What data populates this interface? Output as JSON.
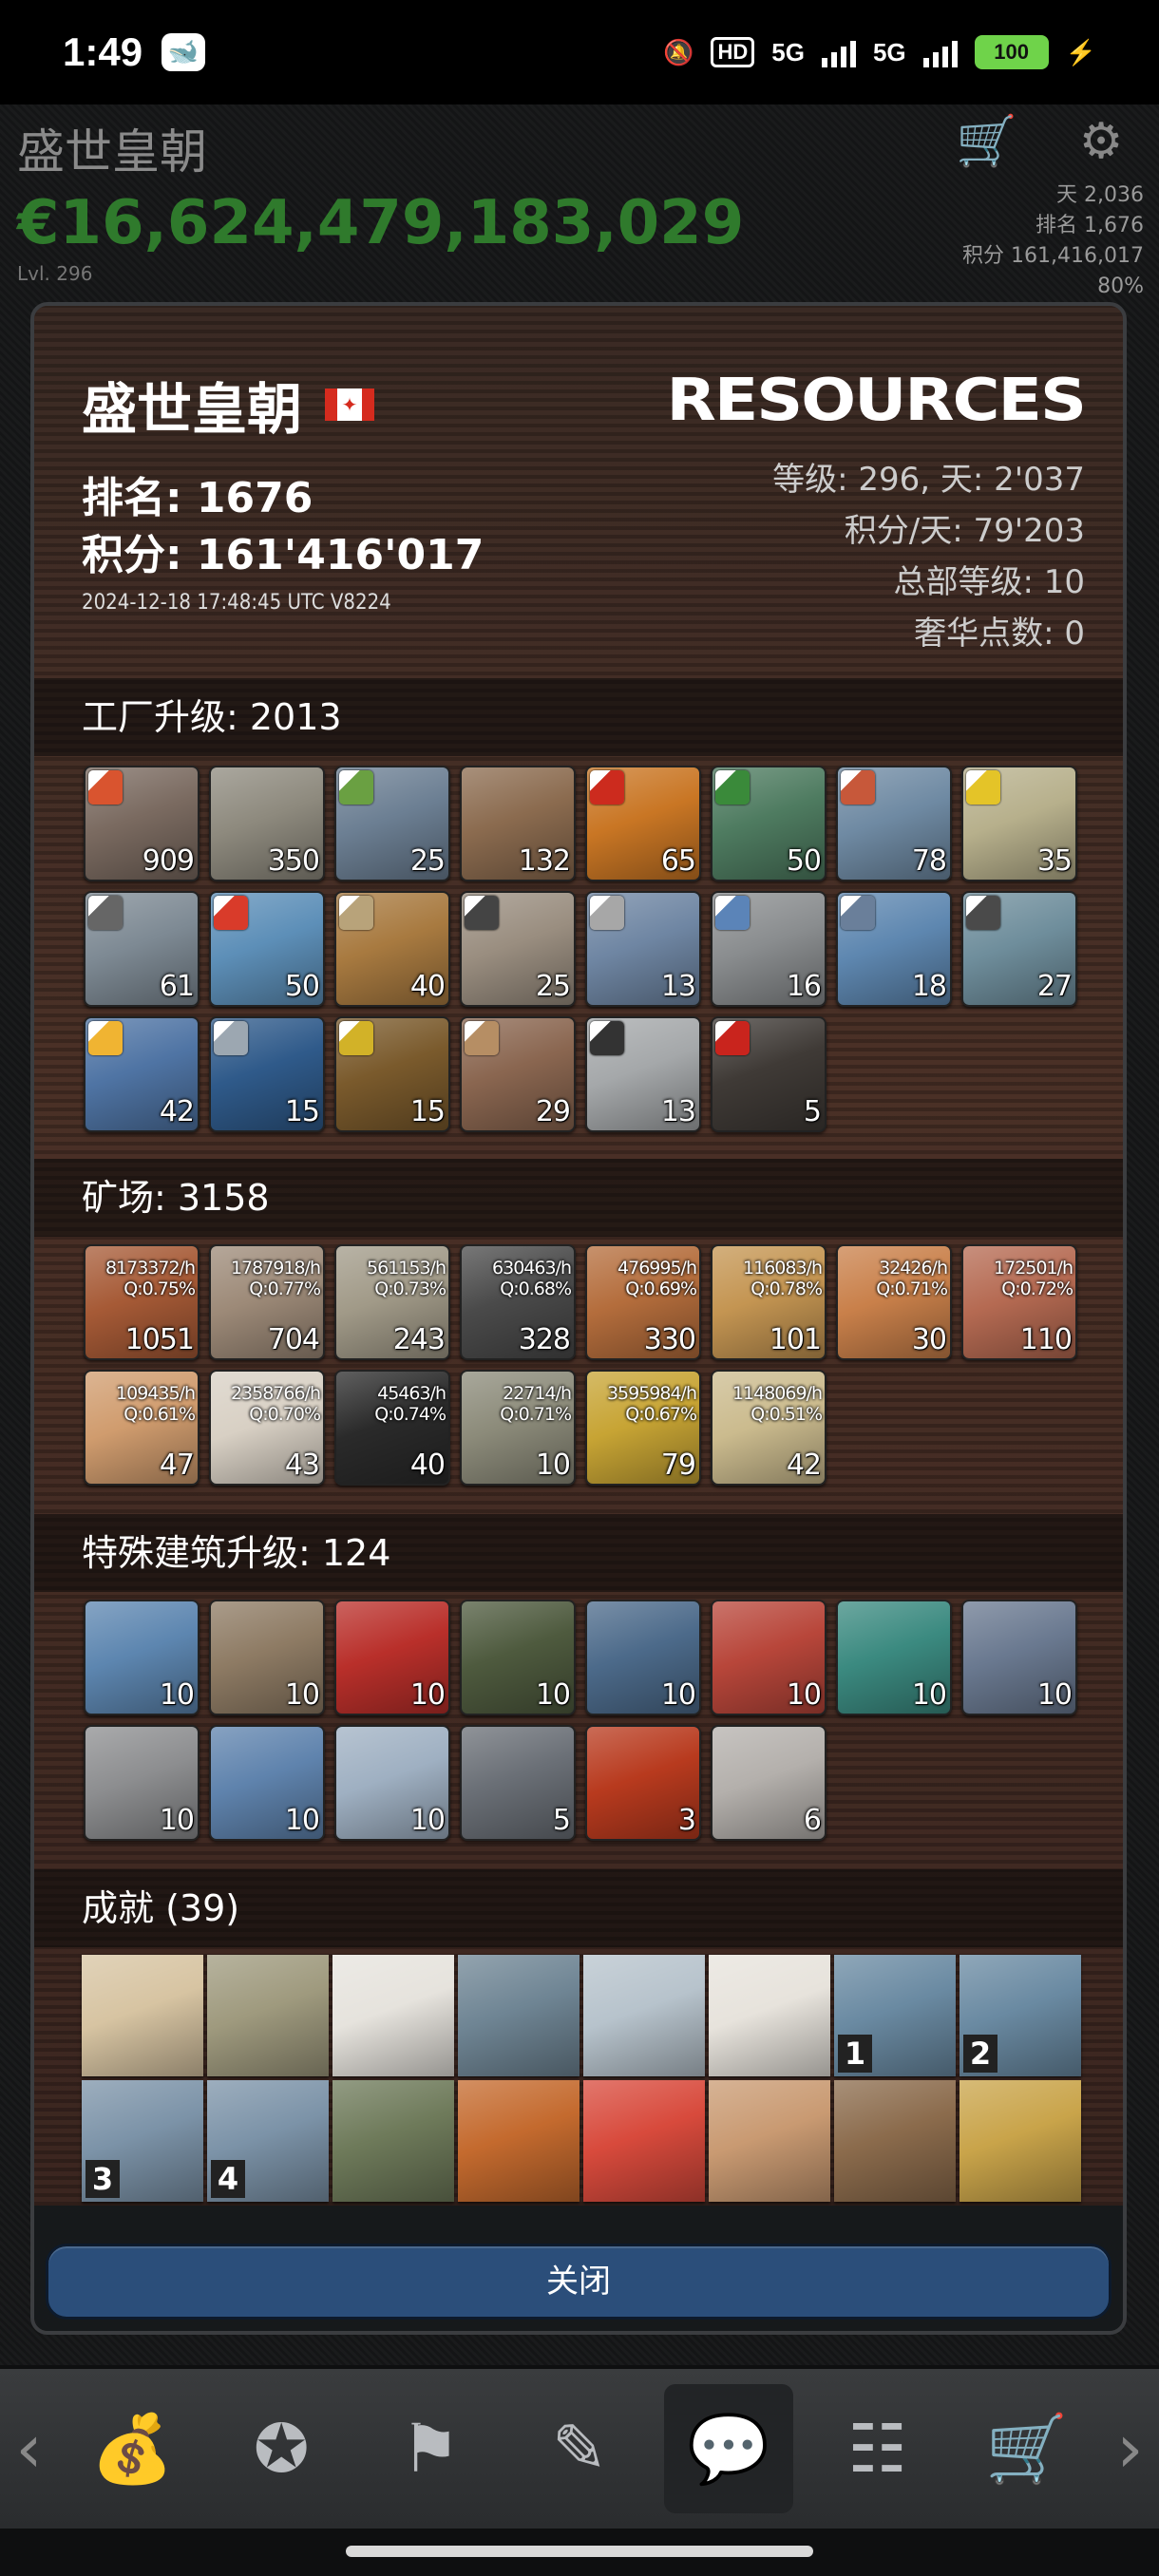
{
  "status_bar": {
    "time": "1:49",
    "net1": "5G",
    "net2": "5G",
    "hd": "HD",
    "battery": "100"
  },
  "game_header": {
    "company_name": "盛世皇朝",
    "cash": "€16,624,479,183,029",
    "level": "Lvl. 296",
    "day": "天 2,036",
    "rank": "排名 1,676",
    "score": "积分 161,416,017",
    "percent": "80%"
  },
  "dialog": {
    "company_name": "盛世皇朝",
    "flag": "canada-flag",
    "rank_label": "排名: 1676",
    "score_label": "积分: 161'416'017",
    "date": "2024-12-18 17:48:45 UTC V8224",
    "logo": "RESOURCES",
    "stats": {
      "level_day": "等级: 296, 天: 2'037",
      "score_per_day": "积分/天: 79'203",
      "hq_level": "总部等级: 10",
      "luxury_points": "奢华点数: 0"
    },
    "factories": {
      "title": "工厂升级: 2013",
      "items": [
        {
          "value": "909",
          "bg": "#7a6a60",
          "badge": "#d9542f"
        },
        {
          "value": "350",
          "bg": "#8e8a7e",
          "badge": ""
        },
        {
          "value": "25",
          "bg": "#6c7f93",
          "badge": "#6aa042"
        },
        {
          "value": "132",
          "bg": "#8b6b4f",
          "badge": ""
        },
        {
          "value": "65",
          "bg": "#c97624",
          "badge": "#cc2b1e"
        },
        {
          "value": "50",
          "bg": "#4e7b60",
          "badge": "#3a8a3a"
        },
        {
          "value": "78",
          "bg": "#6f8aa3",
          "badge": "#c7583a"
        },
        {
          "value": "35",
          "bg": "#b7b08c",
          "badge": "#e4c428"
        },
        {
          "value": "61",
          "bg": "#7e8a94",
          "badge": "#666"
        },
        {
          "value": "50",
          "bg": "#5d8fb8",
          "badge": "#d93b2a"
        },
        {
          "value": "40",
          "bg": "#a87a40",
          "badge": "#b8a37a"
        },
        {
          "value": "25",
          "bg": "#9a8e80",
          "badge": "#444"
        },
        {
          "value": "13",
          "bg": "#6f86a3",
          "badge": "#a7a7a7"
        },
        {
          "value": "16",
          "bg": "#8a8d8f",
          "badge": "#5b84b8"
        },
        {
          "value": "18",
          "bg": "#5e87b0",
          "badge": "#6a7f9a"
        },
        {
          "value": "27",
          "bg": "#6f8e9c",
          "badge": "#4a4a4a"
        },
        {
          "value": "42",
          "bg": "#4f74a4",
          "badge": "#f0b432"
        },
        {
          "value": "15",
          "bg": "#2f5a8a",
          "badge": "#9ca7b1"
        },
        {
          "value": "15",
          "bg": "#7a5a2c",
          "badge": "#d2b228"
        },
        {
          "value": "29",
          "bg": "#8a6650",
          "badge": "#b68e64"
        },
        {
          "value": "13",
          "bg": "#a5a8aa",
          "badge": "#333"
        },
        {
          "value": "5",
          "bg": "#3f3a36",
          "badge": "#c9241d"
        }
      ]
    },
    "mines": {
      "title": "矿场: 3158",
      "items": [
        {
          "rate": "8173372/h",
          "q": "Q:0.75%",
          "value": "1051",
          "bg": "#a65a36"
        },
        {
          "rate": "1787918/h",
          "q": "Q:0.77%",
          "value": "704",
          "bg": "#9d8a78"
        },
        {
          "rate": "561153/h",
          "q": "Q:0.73%",
          "value": "243",
          "bg": "#a19a88"
        },
        {
          "rate": "630463/h",
          "q": "Q:0.68%",
          "value": "328",
          "bg": "#4a4a4a"
        },
        {
          "rate": "476995/h",
          "q": "Q:0.69%",
          "value": "330",
          "bg": "#b46d3c"
        },
        {
          "rate": "116083/h",
          "q": "Q:0.78%",
          "value": "101",
          "bg": "#c49552"
        },
        {
          "rate": "32426/h",
          "q": "Q:0.71%",
          "value": "30",
          "bg": "#c9804a"
        },
        {
          "rate": "172501/h",
          "q": "Q:0.72%",
          "value": "110",
          "bg": "#b56a52"
        },
        {
          "rate": "109435/h",
          "q": "Q:0.61%",
          "value": "47",
          "bg": "#d09c6e"
        },
        {
          "rate": "2358766/h",
          "q": "Q:0.70%",
          "value": "43",
          "bg": "#d8d0c4"
        },
        {
          "rate": "45463/h",
          "q": "Q:0.74%",
          "value": "40",
          "bg": "#2a2a2a"
        },
        {
          "rate": "22714/h",
          "q": "Q:0.71%",
          "value": "10",
          "bg": "#8c8b7a"
        },
        {
          "rate": "3595984/h",
          "q": "Q:0.67%",
          "value": "79",
          "bg": "#c7a434"
        },
        {
          "rate": "1148069/h",
          "q": "Q:0.51%",
          "value": "42",
          "bg": "#cbbb8e"
        }
      ]
    },
    "special": {
      "title": "特殊建筑升级: 124",
      "items": [
        {
          "value": "10",
          "bg": "#5d86b0"
        },
        {
          "value": "10",
          "bg": "#8e7b64"
        },
        {
          "value": "10",
          "bg": "#b92f2a"
        },
        {
          "value": "10",
          "bg": "#4e5a3e"
        },
        {
          "value": "10",
          "bg": "#4c6a8a"
        },
        {
          "value": "10",
          "bg": "#b8463a"
        },
        {
          "value": "10",
          "bg": "#3b8a80"
        },
        {
          "value": "10",
          "bg": "#6a7990"
        },
        {
          "value": "10",
          "bg": "#8d8e90"
        },
        {
          "value": "10",
          "bg": "#5f83ad"
        },
        {
          "value": "10",
          "bg": "#9fb0c2"
        },
        {
          "value": "5",
          "bg": "#6a6f76"
        },
        {
          "value": "3",
          "bg": "#b83a1e"
        },
        {
          "value": "6",
          "bg": "#b4b0ac"
        }
      ]
    },
    "achievements": {
      "title": "成就 (39)",
      "items": [
        {
          "bg": "#d7c4a2",
          "idx": ""
        },
        {
          "bg": "#9f9a7e",
          "idx": ""
        },
        {
          "bg": "#e6e3dd",
          "idx": ""
        },
        {
          "bg": "#6f8594",
          "idx": ""
        },
        {
          "bg": "#b7c3cc",
          "idx": ""
        },
        {
          "bg": "#e7e3dc",
          "idx": ""
        },
        {
          "bg": "#6a8aa2",
          "idx": "1"
        },
        {
          "bg": "#6a8aa2",
          "idx": "2"
        },
        {
          "bg": "#7c93a8",
          "idx": "3"
        },
        {
          "bg": "#7c93a8",
          "idx": "4"
        },
        {
          "bg": "#6e7a5a",
          "idx": ""
        },
        {
          "bg": "#c46a2e",
          "idx": ""
        },
        {
          "bg": "#d84a3c",
          "idx": ""
        },
        {
          "bg": "#c99a72",
          "idx": ""
        },
        {
          "bg": "#8b6b4c",
          "idx": ""
        },
        {
          "bg": "#c9a44a",
          "idx": ""
        }
      ]
    },
    "close_label": "关闭"
  },
  "bottom_nav": [
    {
      "icon": "money-hand-icon",
      "glyph": "💰",
      "active": false
    },
    {
      "icon": "wreath-star-icon",
      "glyph": "✪",
      "active": false
    },
    {
      "icon": "flag-climber-icon",
      "glyph": "⚑",
      "active": false
    },
    {
      "icon": "notes-edit-icon",
      "glyph": "✎",
      "active": false
    },
    {
      "icon": "chat-icon",
      "glyph": "💬",
      "active": true
    },
    {
      "icon": "contacts-icon",
      "glyph": "☷",
      "active": false
    },
    {
      "icon": "cart-icon",
      "glyph": "🛒",
      "active": false
    }
  ]
}
